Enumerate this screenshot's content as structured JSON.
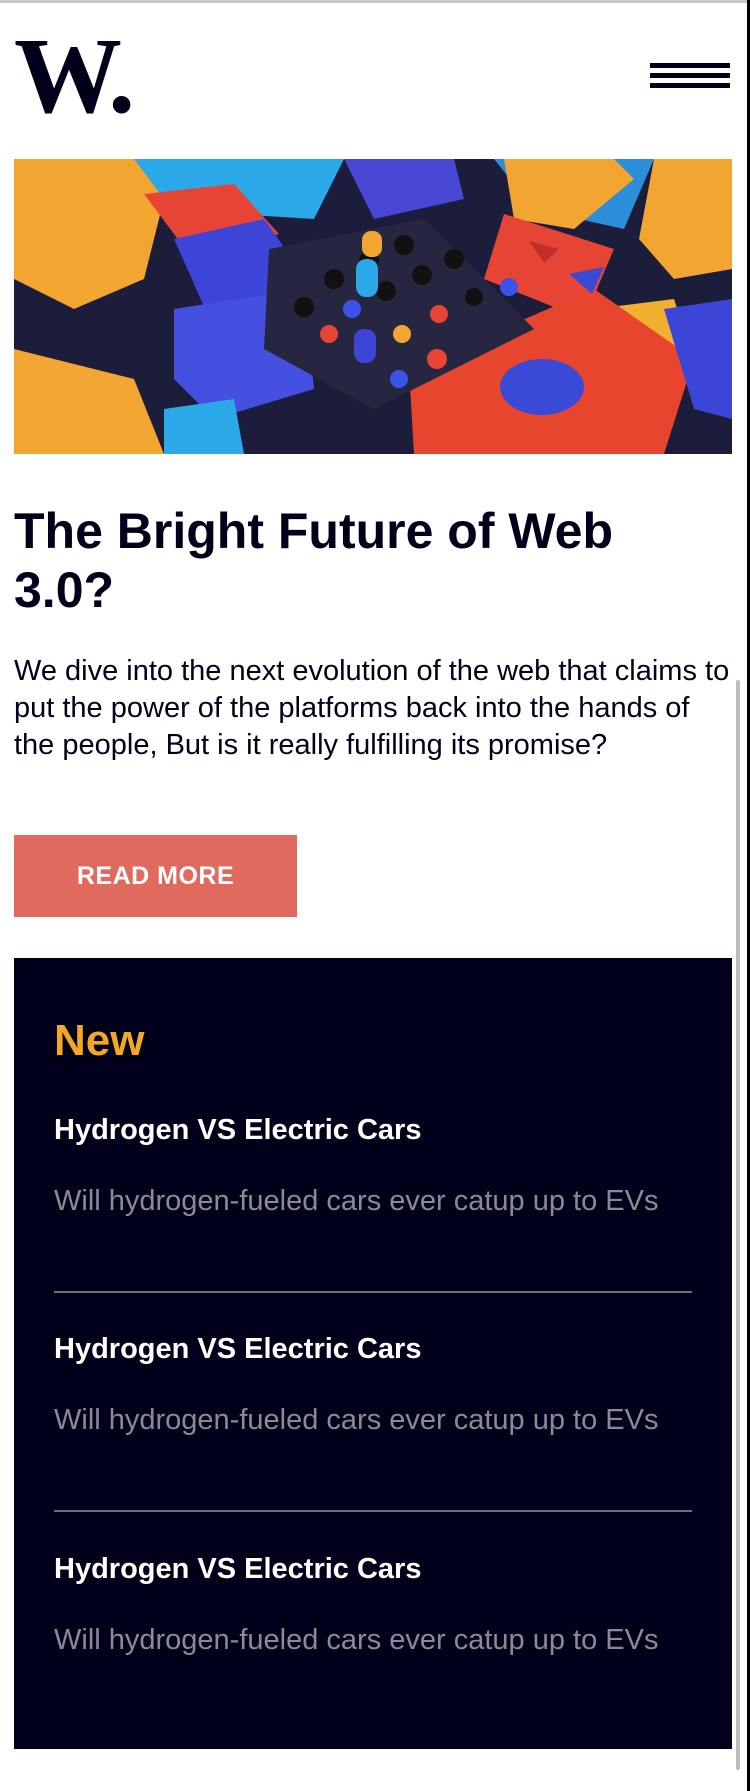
{
  "logo": {
    "text": "W."
  },
  "header": {
    "menu_icon": "hamburger-menu-icon"
  },
  "hero": {
    "image": "abstract-3d-colorful-blocks-illustration"
  },
  "article": {
    "title": "The Bright Future of Web 3.0?",
    "description": "We dive into the next evolution of the web that claims to put the power of the platforms back into the hands of the people, But is it really fulfilling its promise?",
    "read_more_label": "READ MORE"
  },
  "new_section": {
    "heading": "New",
    "items": [
      {
        "title": "Hydrogen VS Electric Cars",
        "description": "Will hydrogen-fueled cars ever catup up to EVs"
      },
      {
        "title": "Hydrogen VS Electric Cars",
        "description": "Will hydrogen-fueled cars ever catup up to EVs"
      },
      {
        "title": "Hydrogen VS Electric Cars",
        "description": "Will hydrogen-fueled cars ever catup up to EVs"
      }
    ]
  },
  "colors": {
    "dark": "#00001a",
    "accent_button": "#e06a5e",
    "new_heading": "#f5a623",
    "muted_text": "#8a8a95"
  }
}
